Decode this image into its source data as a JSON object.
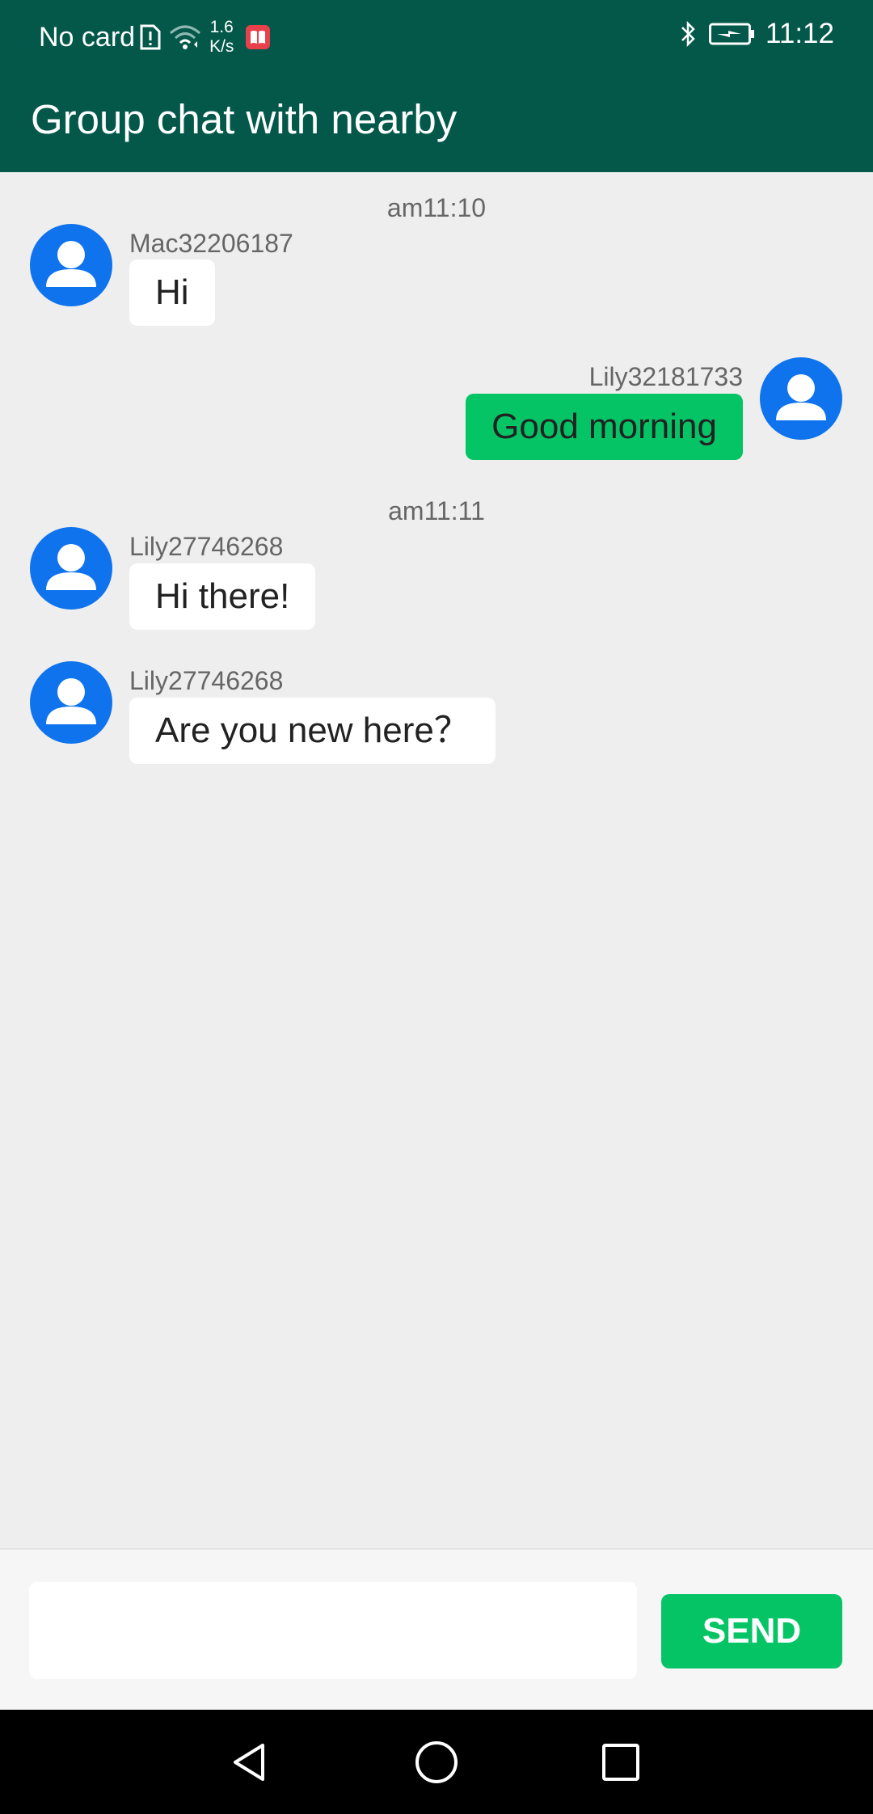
{
  "status_bar": {
    "carrier": "No card",
    "net_speed_value": "1.6",
    "net_speed_unit": "K/s",
    "time": "11:12",
    "icons": [
      "sim-alert-icon",
      "wifi-icon",
      "notification-book-icon",
      "bluetooth-icon",
      "battery-charging-icon"
    ]
  },
  "app_bar": {
    "title": "Group chat with nearby"
  },
  "chat": {
    "timestamps": [
      "am11:10",
      "am11:11"
    ],
    "messages": [
      {
        "sender": "Mac32206187",
        "text": "Hi",
        "direction": "incoming"
      },
      {
        "sender": "Lily32181733",
        "text": "Good morning",
        "direction": "outgoing"
      },
      {
        "sender": "Lily27746268",
        "text": "Hi there!",
        "direction": "incoming"
      },
      {
        "sender": "Lily27746268",
        "text": "Are you new here？",
        "direction": "incoming"
      }
    ]
  },
  "composer": {
    "input_value": "",
    "send_label": "SEND"
  },
  "nav_bar": {
    "icons": [
      "back-icon",
      "home-icon",
      "recents-icon"
    ]
  },
  "colors": {
    "header": "#03584A",
    "background": "#EEEEEE",
    "avatar": "#0F73EE",
    "outgoing_bubble": "#05C466",
    "incoming_bubble": "#FFFFFF",
    "send_button": "#05C466"
  }
}
